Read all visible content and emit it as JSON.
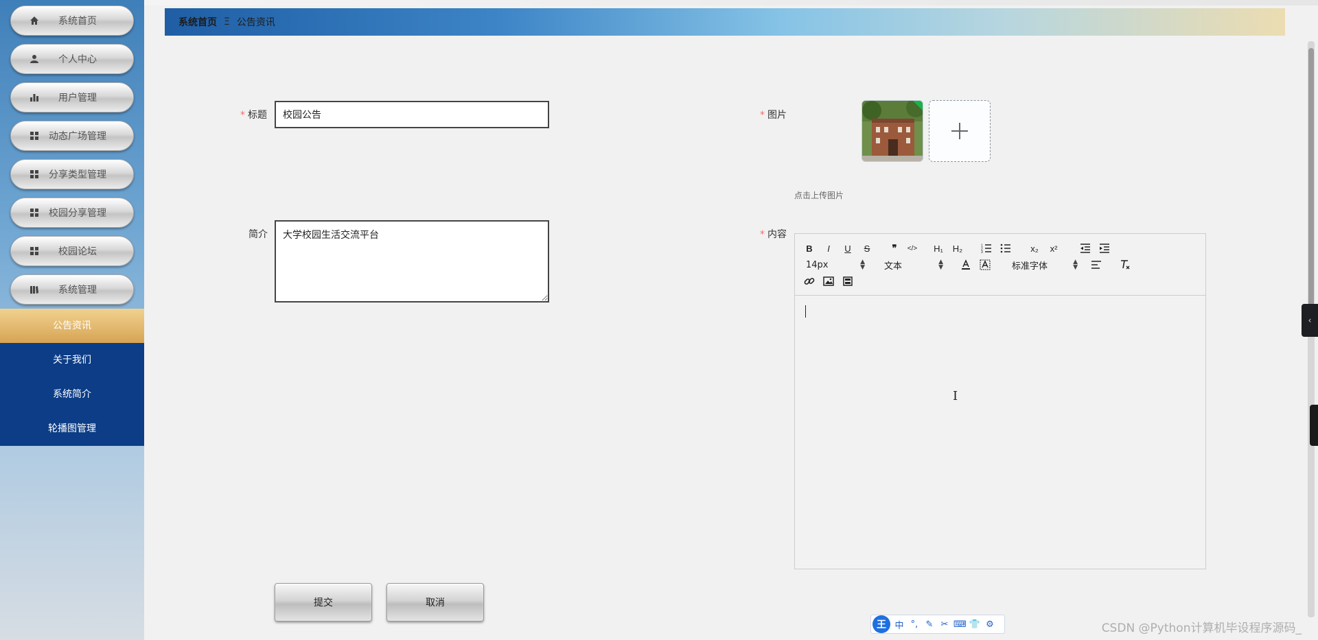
{
  "sidebar": {
    "items": [
      {
        "label": "系统首页",
        "icon": "home-icon"
      },
      {
        "label": "个人中心",
        "icon": "user-icon"
      },
      {
        "label": "用户管理",
        "icon": "bar-chart-icon"
      },
      {
        "label": "动态广场管理",
        "icon": "grid-icon"
      },
      {
        "label": "分享类型管理",
        "icon": "grid-icon"
      },
      {
        "label": "校园分享管理",
        "icon": "grid-icon"
      },
      {
        "label": "校园论坛",
        "icon": "grid-icon"
      },
      {
        "label": "系统管理",
        "icon": "book-icon"
      }
    ],
    "sub_items": [
      {
        "label": "公告资讯",
        "active": true
      },
      {
        "label": "关于我们",
        "active": false
      },
      {
        "label": "系统简介",
        "active": false
      },
      {
        "label": "轮播图管理",
        "active": false
      }
    ]
  },
  "breadcrumb": {
    "home": "系统首页",
    "separator": "Ξ",
    "current": "公告资讯"
  },
  "form": {
    "title_label": "标题",
    "title_value": "校园公告",
    "intro_label": "简介",
    "intro_value": "大学校园生活交流平台",
    "image_label": "图片",
    "upload_tip": "点击上传图片",
    "content_label": "内容",
    "required_mark": "*"
  },
  "editor": {
    "font_size": "14px",
    "header_select": "文本",
    "font_family": "标准字体",
    "tools": {
      "bold": "B",
      "italic": "I",
      "underline": "U",
      "strike": "S",
      "quote": "❞",
      "code": "</>",
      "h1": "H₁",
      "h2": "H₂",
      "subscript": "x₂",
      "superscript": "x²"
    }
  },
  "buttons": {
    "submit": "提交",
    "cancel": "取消"
  },
  "ime": {
    "logo": "王",
    "mode": "中",
    "punct": "°,"
  },
  "watermark": "CSDN @Python计算机毕设程序源码_",
  "colors": {
    "nav_blue": "#0c3d86",
    "active_gold": "#d6a455",
    "required_red": "#f56c6c"
  }
}
